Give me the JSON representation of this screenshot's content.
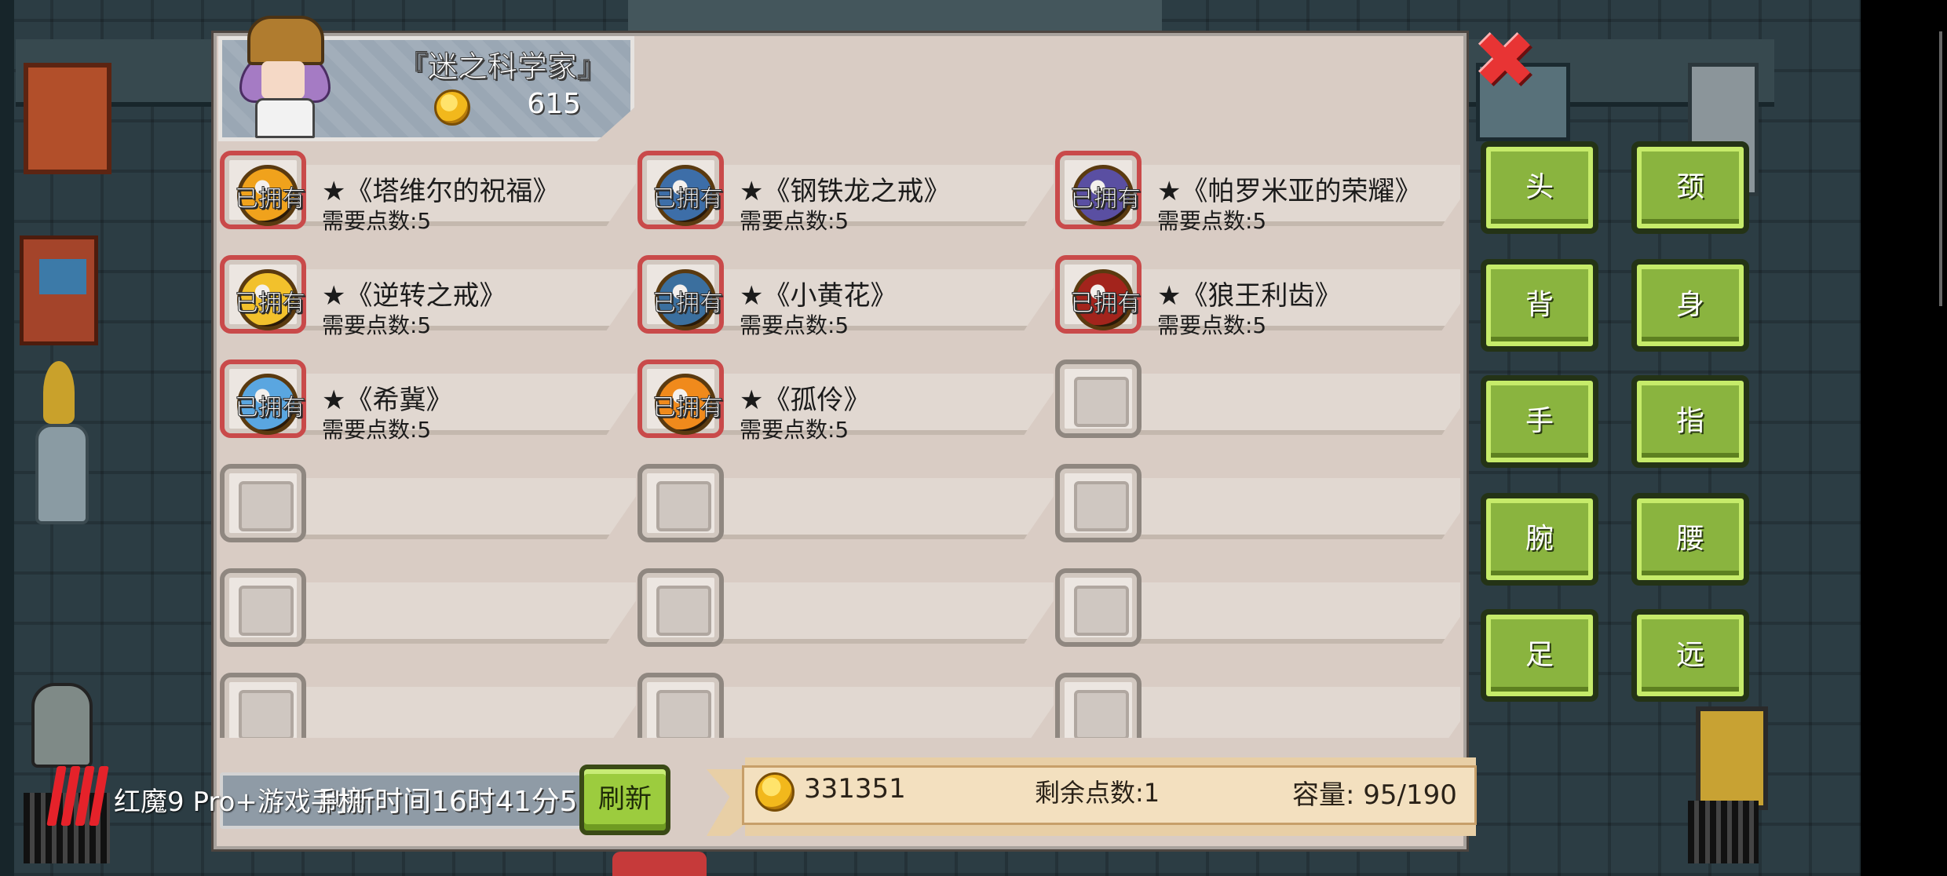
{
  "merchant": {
    "name": "『迷之科学家』",
    "gold": "615"
  },
  "items": [
    {
      "name": "★《塔维尔的祝福》",
      "cost": "需要点数:5",
      "owned": true,
      "color": "#f0a21c"
    },
    {
      "name": "★《钢铁龙之戒》",
      "cost": "需要点数:5",
      "owned": true,
      "color": "#3d6ea8"
    },
    {
      "name": "★《帕罗米亚的荣耀》",
      "cost": "需要点数:5",
      "owned": true,
      "color": "#5a4fa2"
    },
    {
      "name": "★《逆转之戒》",
      "cost": "需要点数:5",
      "owned": true,
      "color": "#f2c12c"
    },
    {
      "name": "★《小黄花》",
      "cost": "需要点数:5",
      "owned": true,
      "color": "#3b6f9e"
    },
    {
      "name": "★《狼王利齿》",
      "cost": "需要点数:5",
      "owned": true,
      "color": "#a3241c"
    },
    {
      "name": "★《希冀》",
      "cost": "需要点数:5",
      "owned": true,
      "color": "#5aa6e0"
    },
    {
      "name": "★《孤伶》",
      "cost": "需要点数:5",
      "owned": true,
      "color": "#f08a1c"
    },
    {
      "name": "",
      "cost": "",
      "owned": false,
      "color": ""
    },
    {
      "name": "",
      "cost": "",
      "owned": false,
      "color": ""
    },
    {
      "name": "",
      "cost": "",
      "owned": false,
      "color": ""
    },
    {
      "name": "",
      "cost": "",
      "owned": false,
      "color": ""
    },
    {
      "name": "",
      "cost": "",
      "owned": false,
      "color": ""
    },
    {
      "name": "",
      "cost": "",
      "owned": false,
      "color": ""
    },
    {
      "name": "",
      "cost": "",
      "owned": false,
      "color": ""
    },
    {
      "name": "",
      "cost": "",
      "owned": false,
      "color": ""
    },
    {
      "name": "",
      "cost": "",
      "owned": false,
      "color": ""
    },
    {
      "name": "",
      "cost": "",
      "owned": false,
      "color": ""
    }
  ],
  "owned_label": "已拥有",
  "bottom": {
    "timer_text": "刷新时间16时41分5",
    "refresh_label": "刷新",
    "gold": "331351",
    "remaining_points": "剩余点数:1",
    "capacity": "容量:  95/190"
  },
  "categories": [
    "头",
    "颈",
    "背",
    "身",
    "手",
    "指",
    "腕",
    "腰",
    "足",
    "远"
  ],
  "close_icon": "✖",
  "system_overlay": {
    "text": "红魔9 Pro+游戏手机"
  }
}
